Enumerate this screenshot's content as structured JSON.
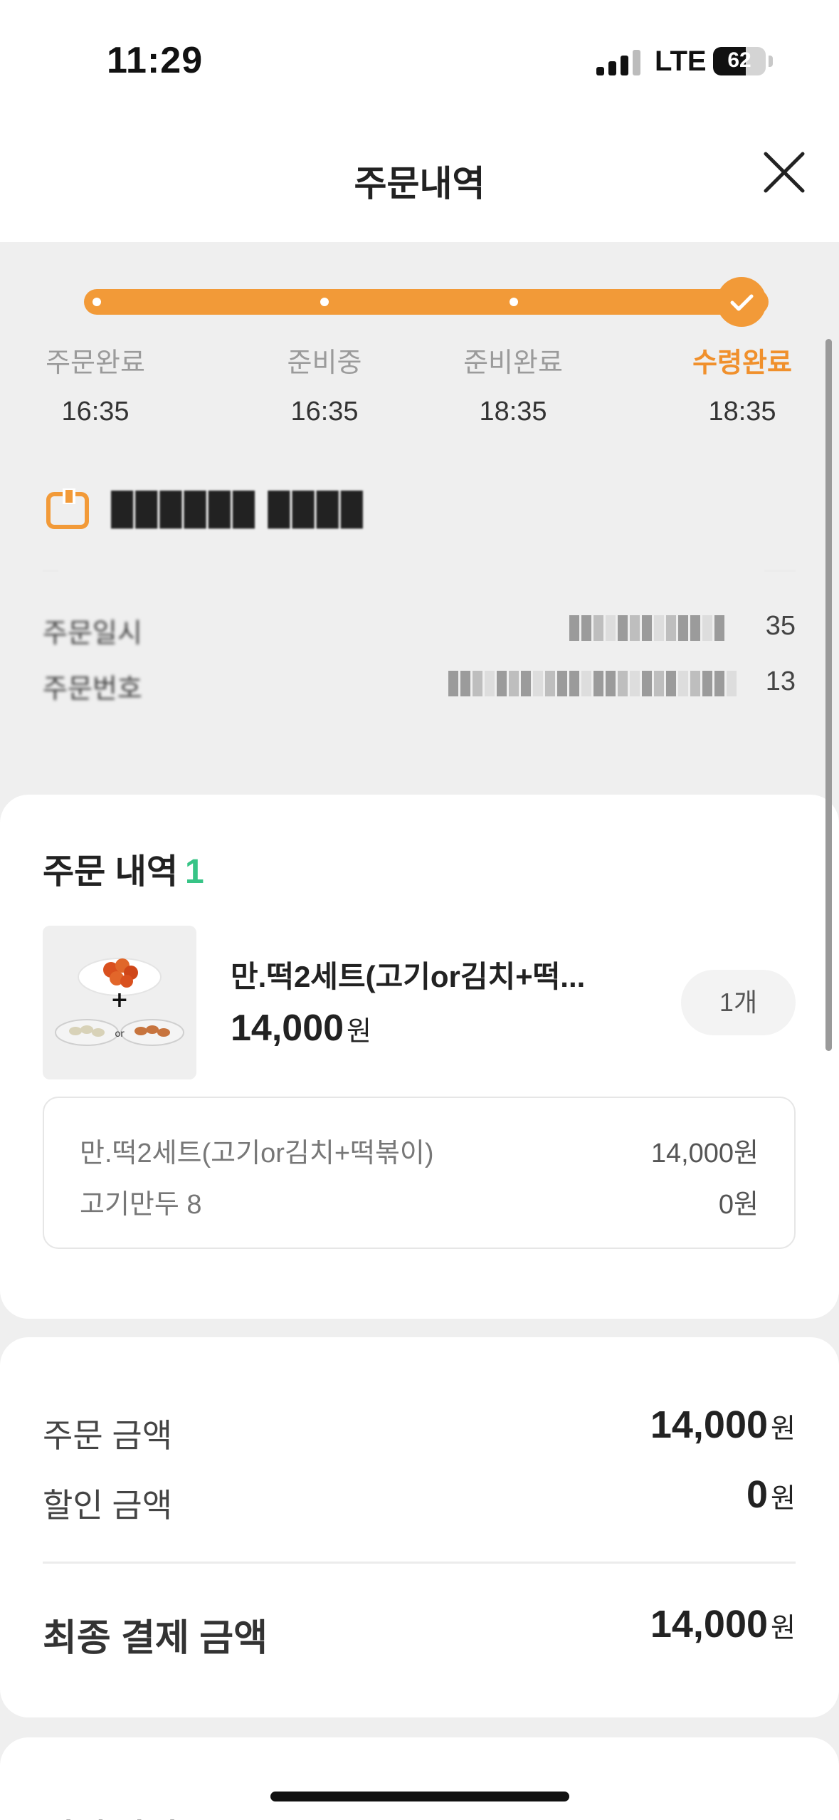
{
  "status_bar": {
    "time": "11:29",
    "network": "LTE",
    "battery": "62",
    "battery_level": 0.62
  },
  "header": {
    "title": "주문내역"
  },
  "progress": {
    "steps": [
      {
        "label": "주문완료",
        "time": "16:35"
      },
      {
        "label": "준비중",
        "time": "16:35"
      },
      {
        "label": "준비완료",
        "time": "18:35"
      },
      {
        "label": "수령완료",
        "time": "18:35"
      }
    ],
    "active_index": 3,
    "accent_color": "#f29a38"
  },
  "store": {
    "name": "██████ ████"
  },
  "order_info": [
    {
      "label": "주문일시",
      "value_suffix": "35"
    },
    {
      "label": "주문번호",
      "value_suffix": "13"
    }
  ],
  "order_items": {
    "title": "주문 내역",
    "count": "1",
    "item": {
      "name": "만.떡2세트(고기or김치+떡...",
      "price": "14,000",
      "price_unit": "원",
      "quantity": "1개"
    },
    "options": [
      {
        "name": "만.떡2세트(고기or김치+떡볶이)",
        "price": "14,000원"
      },
      {
        "name": "고기만두 8",
        "price": "0원"
      }
    ]
  },
  "summary": {
    "order_amount_label": "주문 금액",
    "order_amount": "14,000",
    "discount_label": "할인 금액",
    "discount": "0",
    "final_label": "최종 결제 금액",
    "final_amount": "14,000",
    "unit": "원"
  },
  "payment": {
    "title": "결제 방법"
  }
}
